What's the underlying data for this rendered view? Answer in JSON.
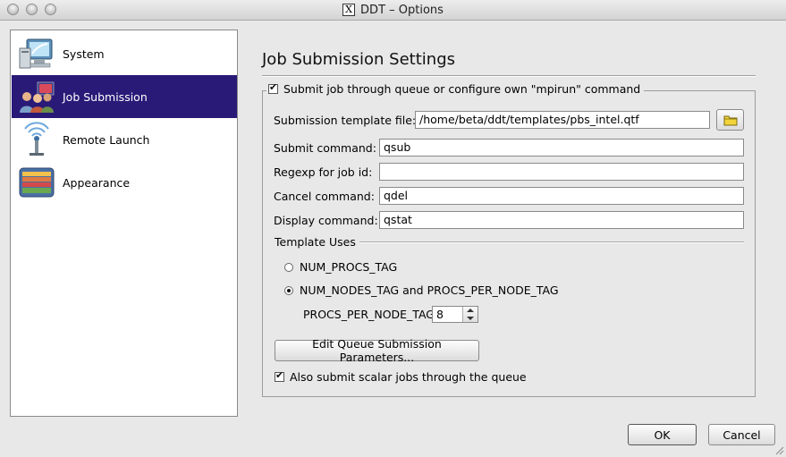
{
  "window": {
    "title": "DDT – Options",
    "x_icon_glyph": "X"
  },
  "sidebar": {
    "items": [
      {
        "label": "System",
        "icon": "computer-icon",
        "selected": false
      },
      {
        "label": "Job Submission",
        "icon": "users-icon",
        "selected": true
      },
      {
        "label": "Remote Launch",
        "icon": "antenna-icon",
        "selected": false
      },
      {
        "label": "Appearance",
        "icon": "palette-icon",
        "selected": false
      }
    ]
  },
  "main": {
    "heading": "Job Submission Settings",
    "group": {
      "title": "Submit job through queue or configure own \"mpirun\" command",
      "checked": true,
      "fields": {
        "template": {
          "label": "Submission template file:",
          "value": "/home/beta/ddt/templates/pbs_intel.qtf"
        },
        "submit": {
          "label": "Submit command:",
          "value": "qsub"
        },
        "regexp": {
          "label": "Regexp for job id:",
          "value": ""
        },
        "cancel": {
          "label": "Cancel command:",
          "value": "qdel"
        },
        "display": {
          "label": "Display command:",
          "value": "qstat"
        }
      },
      "template_uses": {
        "title": "Template Uses",
        "options": [
          {
            "label": "NUM_PROCS_TAG",
            "selected": false
          },
          {
            "label": "NUM_NODES_TAG and PROCS_PER_NODE_TAG",
            "selected": true
          }
        ],
        "procs_per_node": {
          "label": "PROCS_PER_NODE_TAG:",
          "value": "8"
        }
      },
      "edit_button": "Edit Queue Submission Parameters...",
      "scalar": {
        "label": "Also submit scalar jobs through the queue",
        "checked": true
      }
    }
  },
  "footer": {
    "ok": "OK",
    "cancel": "Cancel"
  },
  "colors": {
    "selection": "#2a1a78",
    "window_bg": "#e8e8e8"
  }
}
